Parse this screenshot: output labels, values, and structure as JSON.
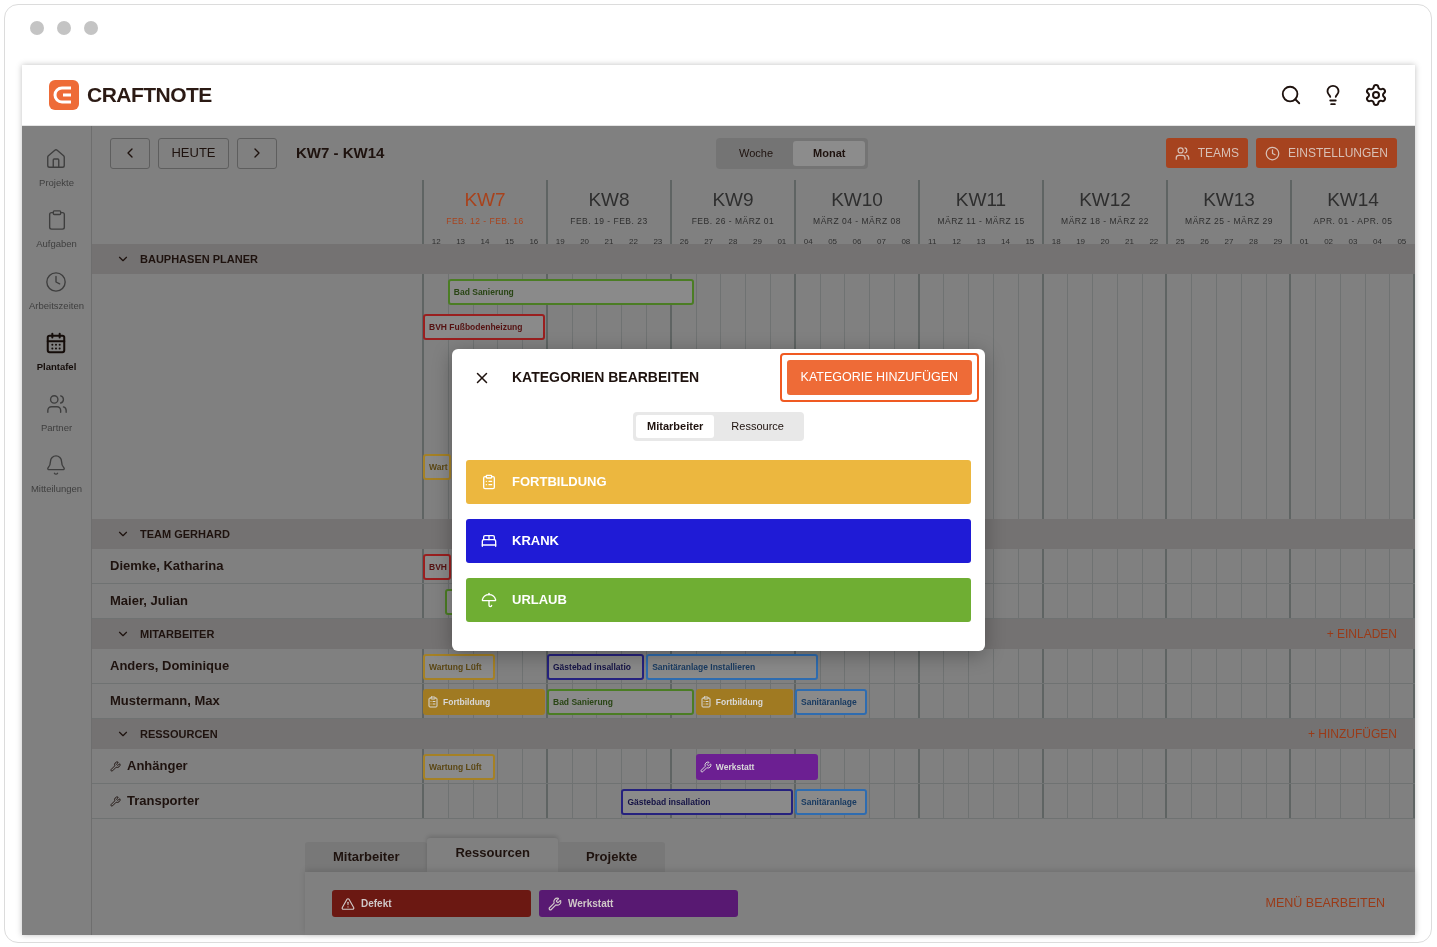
{
  "header": {
    "logo": "CRAFTNOTE"
  },
  "sidebar": {
    "items": [
      {
        "label": "Projekte",
        "selected": false
      },
      {
        "label": "Aufgaben",
        "selected": false
      },
      {
        "label": "Arbeitszeiten",
        "selected": false
      },
      {
        "label": "Plantafel",
        "selected": true
      },
      {
        "label": "Partner",
        "selected": false
      },
      {
        "label": "Mitteilungen",
        "selected": false
      }
    ]
  },
  "toolbar": {
    "today": "HEUTE",
    "range": "KW7 - KW14",
    "view_toggle": [
      {
        "label": "Woche",
        "selected": false
      },
      {
        "label": "Monat",
        "selected": true
      }
    ],
    "buttons": [
      "TEAMS",
      "EINSTELLUNGEN"
    ]
  },
  "weeks": [
    {
      "title": "KW7",
      "dates": "FEB. 12 - FEB. 16",
      "days": [
        "12",
        "13",
        "14",
        "15",
        "16"
      ],
      "current": true
    },
    {
      "title": "KW8",
      "dates": "FEB. 19 - FEB. 23",
      "days": [
        "19",
        "20",
        "21",
        "22",
        "23"
      ],
      "current": false
    },
    {
      "title": "KW9",
      "dates": "FEB. 26 - MÄRZ 01",
      "days": [
        "26",
        "27",
        "28",
        "29",
        "01"
      ],
      "current": false
    },
    {
      "title": "KW10",
      "dates": "MÄRZ 04 - MÄRZ 08",
      "days": [
        "04",
        "05",
        "06",
        "07",
        "08"
      ],
      "current": false
    },
    {
      "title": "KW11",
      "dates": "MÄRZ 11 - MÄRZ 15",
      "days": [
        "11",
        "12",
        "13",
        "14",
        "15"
      ],
      "current": false
    },
    {
      "title": "KW12",
      "dates": "MÄRZ 18 - MÄRZ 22",
      "days": [
        "18",
        "19",
        "20",
        "21",
        "22"
      ],
      "current": false
    },
    {
      "title": "KW13",
      "dates": "MÄRZ 25 - MÄRZ 29",
      "days": [
        "25",
        "26",
        "27",
        "28",
        "29"
      ],
      "current": false
    },
    {
      "title": "KW14",
      "dates": "APR. 01 - APR. 05",
      "days": [
        "01",
        "02",
        "03",
        "04",
        "05"
      ],
      "current": false
    }
  ],
  "sections": [
    {
      "title": "BAUPHASEN PLANER",
      "expanded": true,
      "rows": [
        {
          "kind": "blank",
          "bars": [
            {
              "label": "Bad Sanierung",
              "kind": "project",
              "color": "#4b7d24"
            }
          ]
        },
        {
          "kind": "blank",
          "bars": [
            {
              "label": "BVH Fußbodenheizung",
              "kind": "project",
              "color": "#9a1f1f"
            }
          ]
        },
        {
          "kind": "blank"
        },
        {
          "kind": "blank"
        },
        {
          "kind": "blank"
        },
        {
          "kind": "blank",
          "bars": [
            {
              "label": "Wart",
              "kind": "project",
              "color": "#a58125"
            }
          ]
        },
        {
          "kind": "blank"
        }
      ]
    },
    {
      "title": "TEAM GERHARD",
      "expanded": true,
      "rows": [
        {
          "kind": "person",
          "name": "Diemke, Katharina",
          "bars": [
            {
              "label": "BVH",
              "kind": "project",
              "color": "#9a1f1f"
            }
          ]
        },
        {
          "kind": "person",
          "name": "Maier, Julian",
          "bars": [
            {
              "kind": "project",
              "color": "#4b7d24"
            }
          ]
        }
      ]
    },
    {
      "title": "MITARBEITER",
      "expanded": true,
      "action": "+ EINLADEN",
      "rows": [
        {
          "kind": "person",
          "name": "Anders, Dominique",
          "bars": [
            {
              "label": "Wartung Lüft",
              "kind": "project",
              "color": "#a58125"
            },
            {
              "label": "Gästebad insallatio",
              "kind": "project",
              "color": "#25217e"
            },
            {
              "label": "Sanitäranlage Installieren",
              "kind": "project",
              "color": "#2e6cb0"
            }
          ]
        },
        {
          "kind": "person",
          "name": "Mustermann, Max",
          "bars": [
            {
              "label": "Fortbildung",
              "kind": "training",
              "color": "#a07a22"
            },
            {
              "label": "Bad Sanierung",
              "kind": "project",
              "color": "#4b7d24"
            },
            {
              "label": "Fortbildung",
              "kind": "training",
              "color": "#a07a22"
            },
            {
              "label": "Sanitäranlage",
              "kind": "project",
              "color": "#2e6cb0"
            }
          ]
        }
      ]
    },
    {
      "title": "RESSOURCEN",
      "expanded": true,
      "action": "+ HINZUFÜGEN",
      "rows": [
        {
          "kind": "resource",
          "name": "Anhänger",
          "bars": [
            {
              "label": "Wartung Lüft",
              "kind": "project",
              "color": "#a58125"
            },
            {
              "label": "Werkstatt",
              "kind": "workshop",
              "color": "#6c1f92"
            }
          ]
        },
        {
          "kind": "resource",
          "name": "Transporter",
          "bars": [
            {
              "label": "Gästebad insallation",
              "kind": "project",
              "color": "#25217e"
            },
            {
              "label": "Sanitäranlage",
              "kind": "project",
              "color": "#2e6cb0"
            }
          ]
        }
      ]
    }
  ],
  "bottom_panel": {
    "tabs": [
      {
        "label": "Mitarbeiter",
        "selected": false
      },
      {
        "label": "Ressourcen",
        "selected": true
      },
      {
        "label": "Projekte",
        "selected": false
      }
    ],
    "chips": [
      {
        "label": "Defekt",
        "color": "#6b1812"
      },
      {
        "label": "Werkstatt",
        "color": "#581972"
      }
    ],
    "edit": "MENÜ BEARBEITEN"
  },
  "modal": {
    "title": "KATEGORIEN BEARBEITEN",
    "add_button": "KATEGORIE HINZUFÜGEN",
    "toggle": [
      {
        "label": "Mitarbeiter",
        "selected": true
      },
      {
        "label": "Ressource",
        "selected": false
      }
    ],
    "categories": [
      {
        "label": "FORTBILDUNG",
        "color": "#ecb73f"
      },
      {
        "label": "KRANK",
        "color": "#1f1bd6"
      },
      {
        "label": "URLAUB",
        "color": "#6fae33"
      }
    ]
  }
}
